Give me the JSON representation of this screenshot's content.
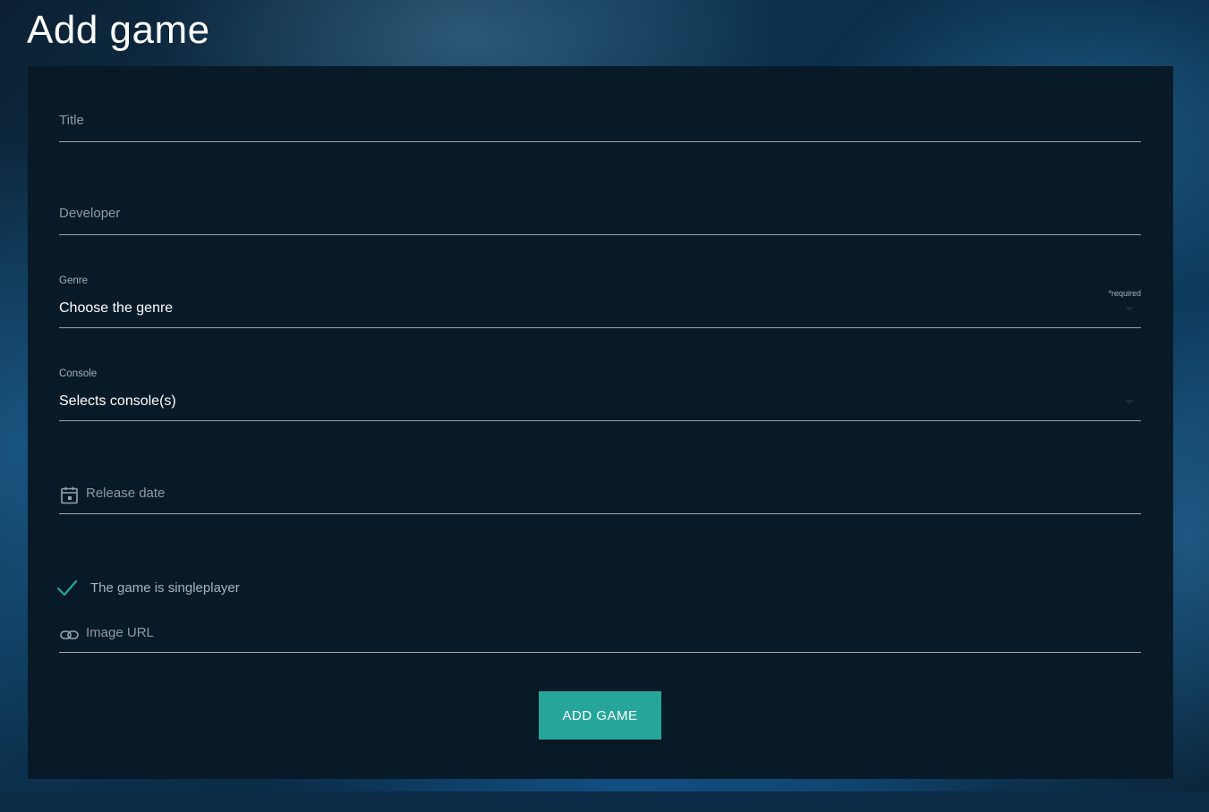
{
  "page": {
    "title": "Add game"
  },
  "form": {
    "title_field": {
      "placeholder": "Title",
      "value": ""
    },
    "developer_field": {
      "placeholder": "Developer",
      "value": ""
    },
    "genre_select": {
      "label": "Genre",
      "selected": "Choose the genre",
      "helper": "*required"
    },
    "console_select": {
      "label": "Console",
      "selected": "Selects console(s)"
    },
    "release_date_field": {
      "placeholder": "Release date",
      "icon": "calendar-icon"
    },
    "singleplayer_checkbox": {
      "label": "The game is singleplayer",
      "checked": true,
      "icon": "checkmark-icon"
    },
    "image_url_field": {
      "placeholder": "Image URL",
      "icon": "link-icon"
    },
    "submit_button": {
      "label": "ADD GAME"
    }
  },
  "colors": {
    "accent": "#26a69a",
    "card_background": "#081a27",
    "text_primary": "#ffffff",
    "text_muted": "#8f9aa1"
  }
}
